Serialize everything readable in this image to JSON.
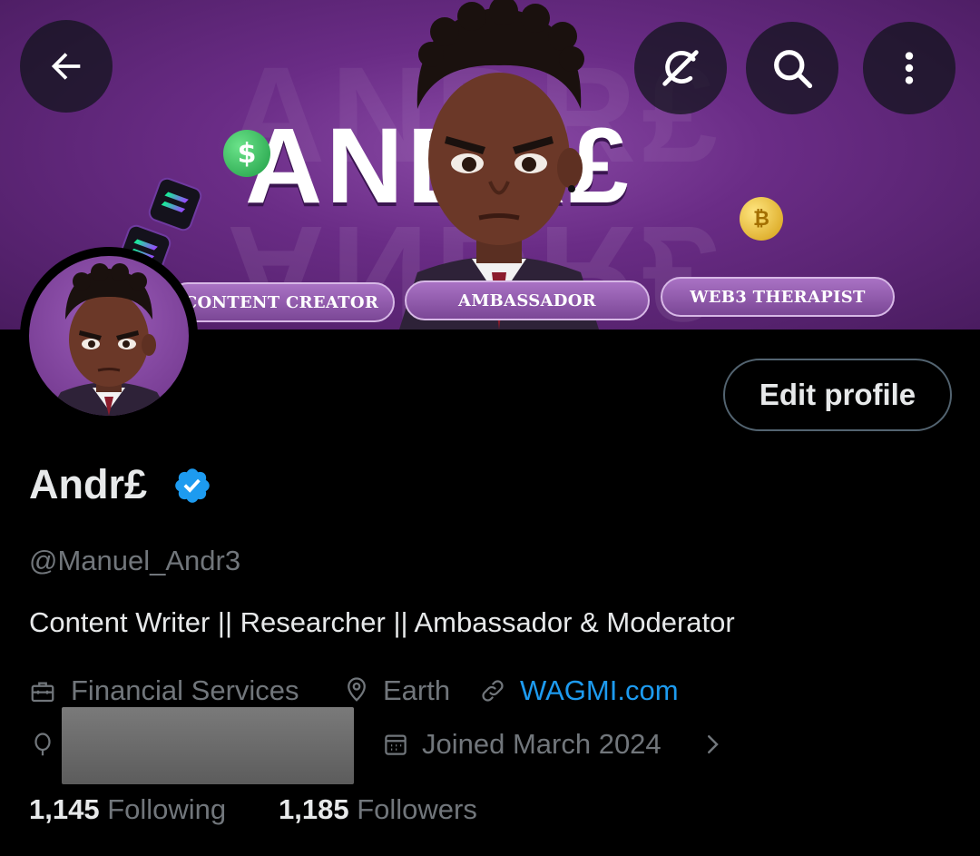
{
  "banner": {
    "title_text": "ANDR£",
    "tags": [
      "CONTENT CREATOR",
      "AMBASSADOR",
      "WEB3 THERAPIST"
    ]
  },
  "nav": {
    "back_icon": "arrow-left-icon",
    "grok_icon": "grok-icon",
    "search_icon": "search-icon",
    "more_icon": "more-vertical-icon"
  },
  "profile": {
    "display_name": "Andr£",
    "verified": true,
    "handle": "@Manuel_Andr3",
    "bio": "Content Writer || Researcher || Ambassador & Moderator",
    "edit_label": "Edit profile"
  },
  "meta": {
    "category": "Financial Services",
    "location": "Earth",
    "website": "WAGMI.com",
    "joined": "Joined March 2024"
  },
  "stats": {
    "following_count": "1,145",
    "following_label": "Following",
    "followers_count": "1,185",
    "followers_label": "Followers"
  },
  "colors": {
    "background": "#000000",
    "primary_text": "#e7e9ea",
    "secondary_text": "#71767b",
    "link": "#1d9bf0",
    "verified_badge": "#1d9bf0",
    "banner_purple": "#6a2c86"
  }
}
